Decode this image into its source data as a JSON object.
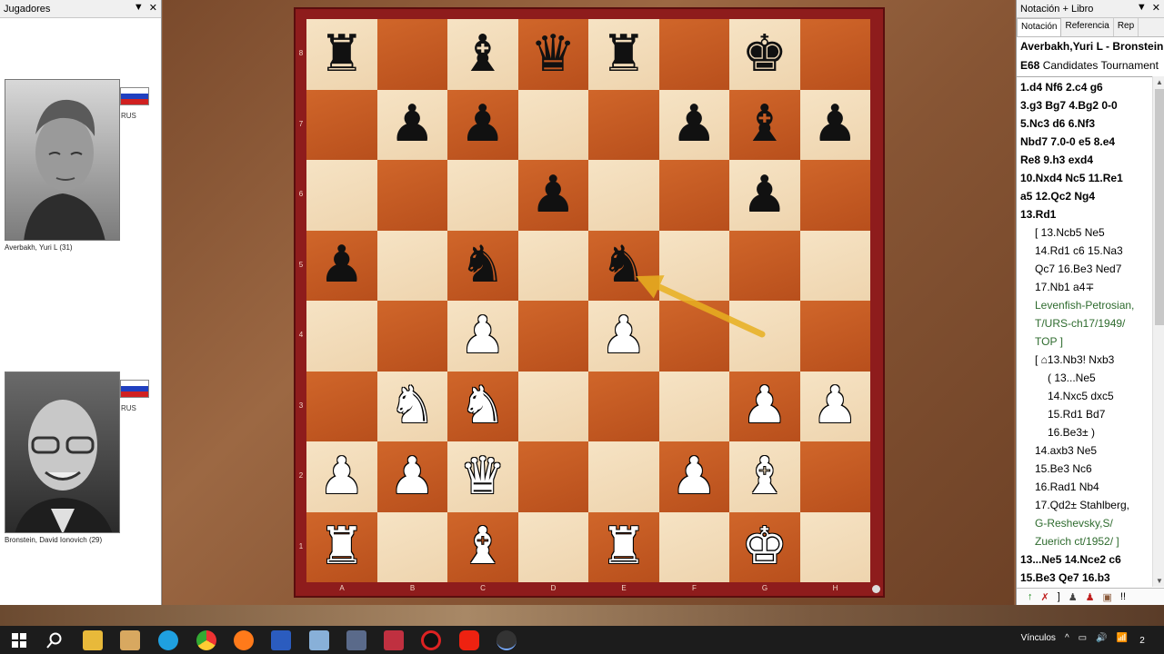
{
  "left_panel": {
    "title": "Jugadores",
    "controls": [
      "▼",
      "✕"
    ],
    "players": [
      {
        "name": "Averbakh, Yuri L  (31)",
        "country": "RUS"
      },
      {
        "name": "Bronstein, David Ionovich  (29)",
        "country": "RUS"
      }
    ]
  },
  "board": {
    "ranks": [
      "8",
      "7",
      "6",
      "5",
      "4",
      "3",
      "2",
      "1"
    ],
    "files": [
      "A",
      "B",
      "C",
      "D",
      "E",
      "F",
      "G",
      "H"
    ],
    "position": [
      [
        "r",
        "",
        "b",
        "q",
        "r",
        "",
        "k",
        ""
      ],
      [
        "",
        "p",
        "p",
        "",
        "",
        "p",
        "b",
        "p"
      ],
      [
        "",
        "",
        "",
        "p",
        "",
        "",
        "p",
        ""
      ],
      [
        "p",
        "",
        "n",
        "",
        "n",
        "",
        "",
        ""
      ],
      [
        "",
        "",
        "P",
        "",
        "P",
        "",
        "",
        ""
      ],
      [
        "",
        "N",
        "N",
        "",
        "",
        "",
        "P",
        "P"
      ],
      [
        "P",
        "P",
        "Q",
        "",
        "",
        "P",
        "B",
        ""
      ],
      [
        "R",
        "",
        "B",
        "",
        "R",
        "",
        "K",
        ""
      ]
    ],
    "arrow_color": "#e8b020"
  },
  "right_panel": {
    "title": "Notación + Libro",
    "controls": [
      "▼",
      "✕"
    ],
    "tabs": [
      "Notación",
      "Referencia",
      "Rep"
    ],
    "game_players": "Averbakh,Yuri L - Bronstein",
    "game_event_code": "E68",
    "game_event": "Candidates Tournament",
    "lines": [
      {
        "text": "1.d4  Nf6  2.c4  g6",
        "indent": 0,
        "style": "bold"
      },
      {
        "text": "3.g3  Bg7  4.Bg2  0-0",
        "indent": 0,
        "style": "bold"
      },
      {
        "text": "5.Nc3  d6  6.Nf3",
        "indent": 0,
        "style": "bold"
      },
      {
        "text": "Nbd7  7.0-0  e5  8.e4",
        "indent": 0,
        "style": "bold"
      },
      {
        "text": "Re8  9.h3  exd4",
        "indent": 0,
        "style": "bold"
      },
      {
        "text": "10.Nxd4  Nc5  11.Re1",
        "indent": 0,
        "style": "bold"
      },
      {
        "text": "a5  12.Qc2  Ng4",
        "indent": 0,
        "style": "bold"
      },
      {
        "text": "13.Rd1",
        "indent": 0,
        "style": "bold"
      },
      {
        "text": "[ 13.Ncb5  Ne5",
        "indent": 1,
        "style": "plain"
      },
      {
        "text": "14.Rd1  c6  15.Na3",
        "indent": 1,
        "style": "plain"
      },
      {
        "text": "Qc7  16.Be3  Ned7",
        "indent": 1,
        "style": "plain"
      },
      {
        "text": "17.Nb1  a4∓",
        "indent": 1,
        "style": "plain"
      },
      {
        "text": "Levenfish-Petrosian,",
        "indent": 1,
        "style": "green"
      },
      {
        "text": "T/URS-ch17/1949/",
        "indent": 1,
        "style": "green"
      },
      {
        "text": "TOP ]",
        "indent": 1,
        "style": "green"
      },
      {
        "text": "[ ⌂13.Nb3!  Nxb3",
        "indent": 1,
        "style": "plain"
      },
      {
        "text": "( 13...Ne5",
        "indent": 2,
        "style": "plain"
      },
      {
        "text": "14.Nxc5  dxc5",
        "indent": 2,
        "style": "plain"
      },
      {
        "text": "15.Rd1  Bd7",
        "indent": 2,
        "style": "plain"
      },
      {
        "text": "16.Be3± )",
        "indent": 2,
        "style": "plain"
      },
      {
        "text": "14.axb3  Ne5",
        "indent": 1,
        "style": "plain"
      },
      {
        "text": "15.Be3  Nc6",
        "indent": 1,
        "style": "plain"
      },
      {
        "text": "16.Rad1  Nb4",
        "indent": 1,
        "style": "plain"
      },
      {
        "text": "17.Qd2±  Stahlberg,",
        "indent": 1,
        "style": "plain"
      },
      {
        "text": "G-Reshevsky,S/",
        "indent": 1,
        "style": "green"
      },
      {
        "text": "Zuerich ct/1952/ ]",
        "indent": 1,
        "style": "green"
      },
      {
        "text": "13...Ne5  14.Nce2  c6",
        "indent": 0,
        "style": "bold"
      },
      {
        "text": "15.Be3  Qe7  16.b3",
        "indent": 0,
        "style": "bold"
      }
    ],
    "toolbar": [
      "↑",
      "✗",
      "]",
      "♟",
      "♟",
      "▣",
      "!!"
    ]
  },
  "taskbar": {
    "tray_label": "Vínculos",
    "tray_icons": [
      "^",
      "▭",
      "🔊",
      "📶"
    ],
    "notification_count": "2"
  }
}
